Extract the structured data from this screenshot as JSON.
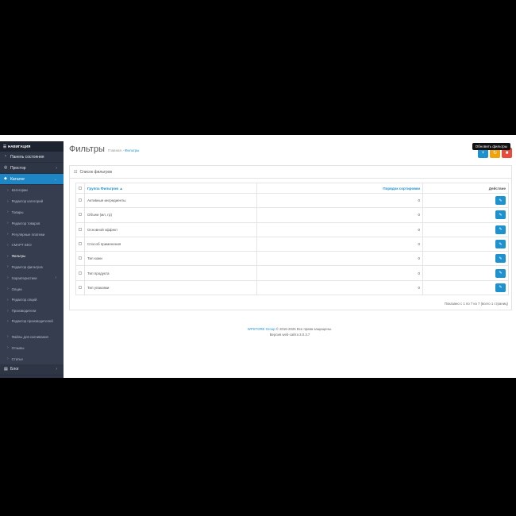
{
  "topbar": {
    "text": ""
  },
  "sidebar": {
    "header": "НАВИГАЦИЯ",
    "items": [
      {
        "label": "Панель состояния",
        "icon": "dashboard-icon"
      },
      {
        "label": "Простор",
        "icon": "globe-icon"
      },
      {
        "label": "Каталог",
        "icon": "tag-icon",
        "active": true
      }
    ],
    "catalog_sub": [
      "Категории",
      "Редактор категорий",
      "Товары",
      "Редактор товаров",
      "Регулярные платежи",
      "СМАРТ SEO",
      "Фильтры",
      "Редактор фильтров",
      "Характеристики",
      "Опции",
      "Редактор опций",
      "Производители",
      "Редактор производителей",
      "Файлы для скачивания",
      "Отзывы",
      "Статьи"
    ],
    "last_item": "Блог"
  },
  "header": {
    "title": "Фильтры",
    "breadcrumb_home": "Главная",
    "breadcrumb_current": "Фильтры",
    "tooltip": "Обновить фильтры"
  },
  "panel": {
    "title": "Список фильтров"
  },
  "table": {
    "headers": {
      "name": "Группа Фильтров ▲",
      "sort": "Порядок сортировки",
      "action": "Действие"
    },
    "rows": [
      {
        "name": "Активные ингредиенты",
        "sort": "0"
      },
      {
        "name": "Объем (мл, гр)",
        "sort": "0"
      },
      {
        "name": "Основной эффект",
        "sort": "0"
      },
      {
        "name": "Способ применения",
        "sort": "0"
      },
      {
        "name": "Тип кожи",
        "sort": "0"
      },
      {
        "name": "Тип продукта",
        "sort": "0"
      },
      {
        "name": "Тип упаковки",
        "sort": "0"
      }
    ],
    "pagination": "Показано с 1 по 7 из 7 (всего 1 страниц)"
  },
  "footer": {
    "brand": "WPSTORE Group",
    "rights": " © 2016-2025 Все права защищены.",
    "version": "Версия web-сайта 3.0.3.7"
  },
  "colors": {
    "sidebar": "#2e3545",
    "accent": "#1e91cf",
    "orange": "#f0a30a",
    "red": "#e74c3c",
    "active_nav": "#1f86c6"
  }
}
